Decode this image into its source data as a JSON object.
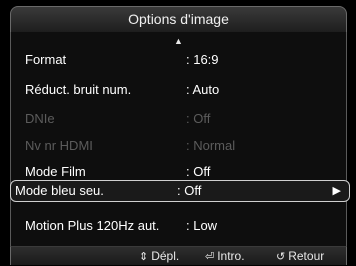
{
  "title": "Options d'image",
  "scroll": {
    "up_icon": "▲",
    "down_icon": "▼"
  },
  "items": [
    {
      "label": "Format",
      "value": ": 16:9",
      "state": "enabled"
    },
    {
      "label": "Réduct. bruit num.",
      "value": ": Auto",
      "state": "enabled"
    },
    {
      "label": "DNIe",
      "value": ": Off",
      "state": "disabled"
    },
    {
      "label": "Nv nr HDMI",
      "value": ": Normal",
      "state": "disabled"
    },
    {
      "label": "Mode Film",
      "value": ": Off",
      "state": "enabled"
    },
    {
      "label": "Mode bleu seu.",
      "value": ": Off",
      "state": "selected",
      "submenu_icon": "▶"
    },
    {
      "label": "Motion Plus 120Hz aut.",
      "value": ": Low",
      "state": "enabled"
    }
  ],
  "footer": {
    "move_icon": "⇕",
    "move_label": "Dépl.",
    "enter_icon": "⏎",
    "enter_label": "Intro.",
    "return_icon": "↺",
    "return_label": "Retour"
  }
}
